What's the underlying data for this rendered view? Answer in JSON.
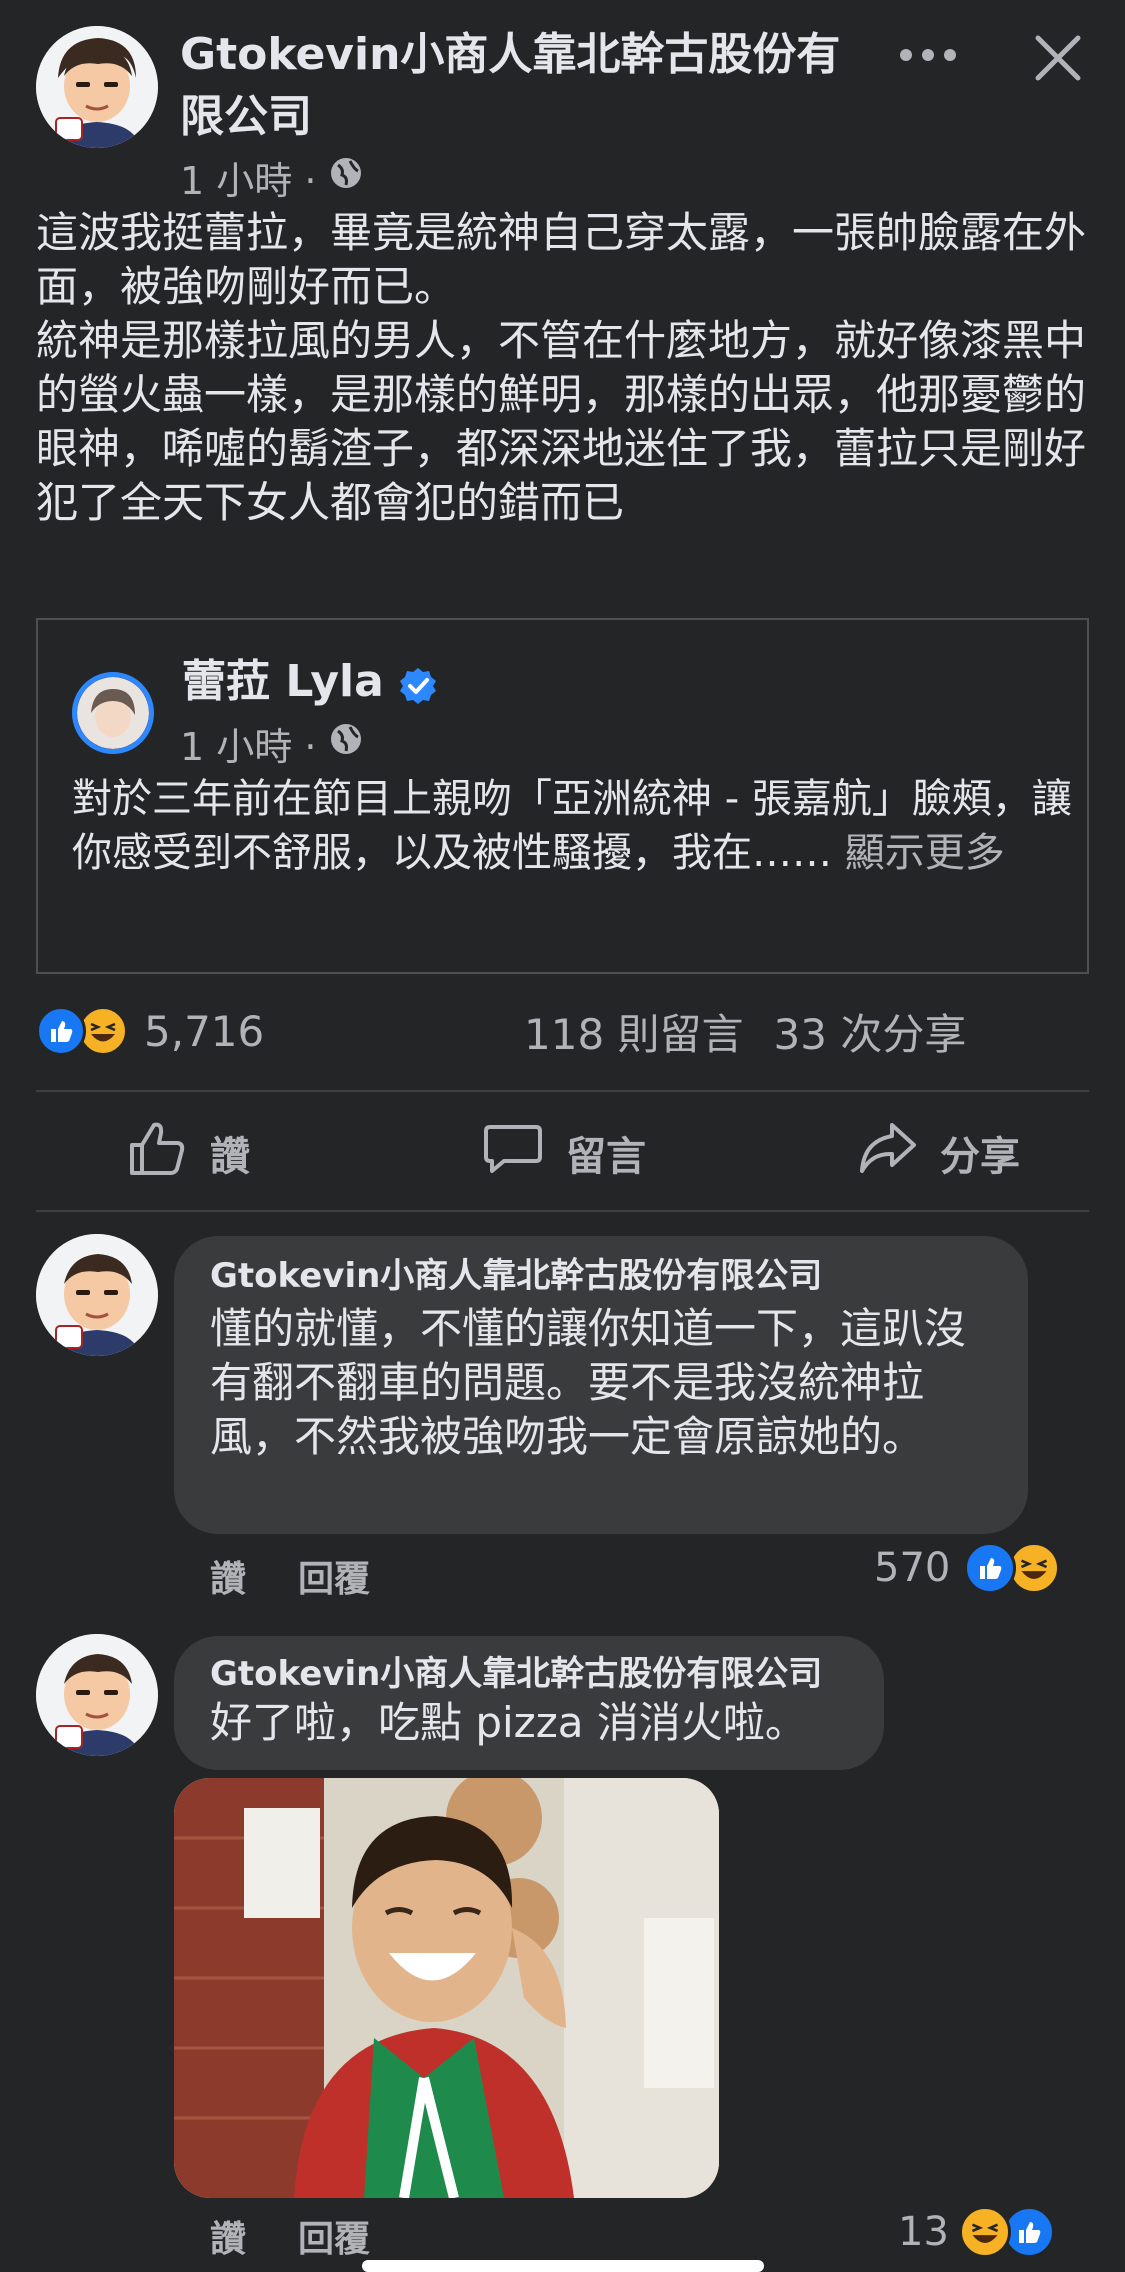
{
  "post": {
    "author": "Gtokevin小商人靠北幹古股份有限公司",
    "time": "1 小時 ·",
    "body": "這波我挺蕾拉，畢竟是統神自己穿太露，一張帥臉露在外面，被強吻剛好而已。\n統神是那樣拉風的男人，不管在什麼地方，就好像漆黑中的螢火蟲一樣，是那樣的鮮明，那樣的出眾，他那憂鬱的眼神，唏噓的鬍渣子，都深深地迷住了我，蕾拉只是剛好犯了全天下女人都會犯的錯而已"
  },
  "shared": {
    "author": "蕾菈 Lyla",
    "time": "1 小時 ·",
    "body": "對於三年前在節目上親吻「亞洲統神 - 張嘉航」臉頰，讓你感受到不舒服，以及被性騷擾，我在……",
    "see_more": "顯示更多"
  },
  "stats": {
    "reactions": "5,716",
    "comments": "118 則留言",
    "shares": "33 次分享"
  },
  "actions": {
    "like": "讚",
    "comment": "留言",
    "share": "分享"
  },
  "comments": [
    {
      "author": "Gtokevin小商人靠北幹古股份有限公司",
      "text": "懂的就懂，不懂的讓你知道一下，這趴沒有翻不翻車的問題。要不是我沒統神拉風，不然我被強吻我一定會原諒她的。",
      "like": "讚",
      "reply": "回覆",
      "reactions": "570"
    },
    {
      "author": "Gtokevin小商人靠北幹古股份有限公司",
      "text": "好了啦，吃點 pizza 消消火啦。",
      "like": "讚",
      "reply": "回覆",
      "reactions": "13"
    }
  ],
  "colors": {
    "background": "#242526",
    "bubble": "#3a3b3c",
    "like_blue": "#1877f2",
    "haha_yellow": "#f7b125",
    "text_secondary": "#b0b3b8"
  },
  "icons": [
    "avatar",
    "more-dots-icon",
    "close-icon",
    "globe-icon",
    "verified-badge-icon",
    "like-reaction-icon",
    "haha-reaction-icon",
    "thumbs-up-icon",
    "comment-icon",
    "share-icon"
  ]
}
